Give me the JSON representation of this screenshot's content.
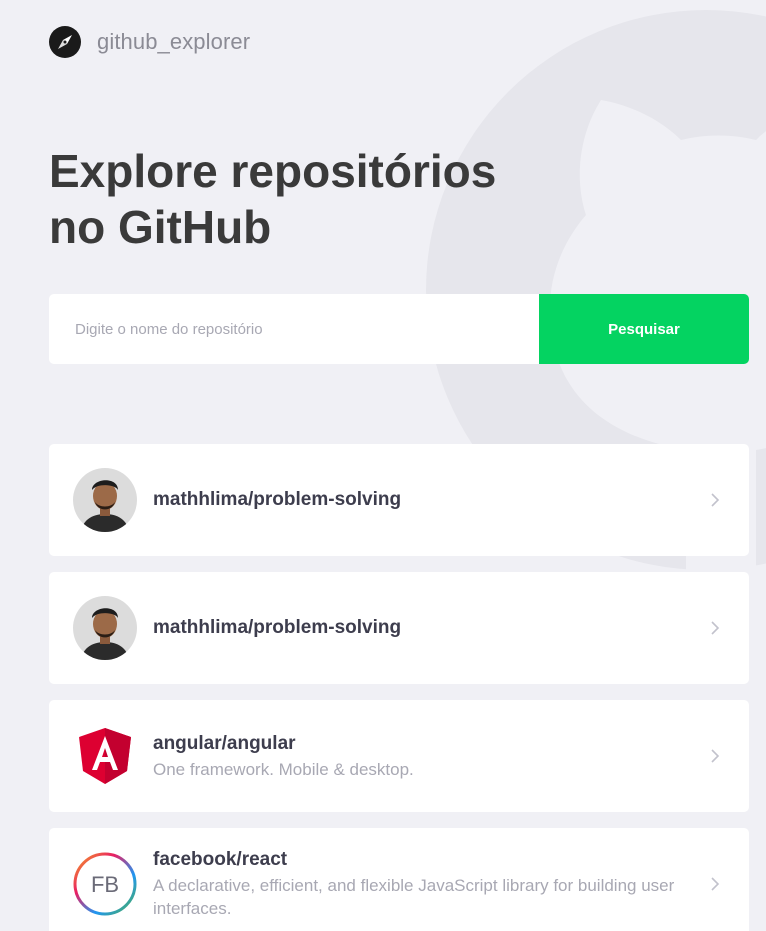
{
  "header": {
    "logo_icon": "compass-icon",
    "app_name": "github_explorer"
  },
  "hero": {
    "title_line1": "Explore repositórios",
    "title_line2": "no GitHub"
  },
  "search": {
    "placeholder": "Digite o nome do repositório",
    "value": "",
    "button_label": "Pesquisar"
  },
  "colors": {
    "background": "#f0f0f5",
    "accent": "#04d361",
    "title": "#3a3a3a",
    "muted": "#a8a8b3"
  },
  "repositories": [
    {
      "name": "mathhlima/problem-solving",
      "description": "",
      "avatar": "user-photo-avatar"
    },
    {
      "name": "mathhlima/problem-solving",
      "description": "",
      "avatar": "user-photo-avatar"
    },
    {
      "name": "angular/angular",
      "description": "One framework. Mobile & desktop.",
      "avatar": "angular-logo-avatar"
    },
    {
      "name": "facebook/react",
      "description": "A declarative, efficient, and flexible JavaScript library for building user interfaces.",
      "avatar": "facebook-logo-avatar",
      "avatar_text": "FB"
    }
  ]
}
